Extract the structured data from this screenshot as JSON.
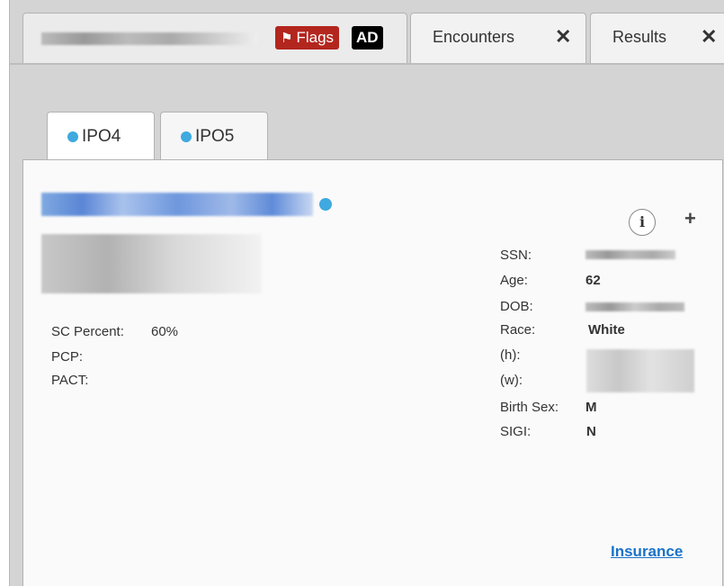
{
  "tabs": {
    "patient": {
      "flags_label": "Flags",
      "ad_label": "AD"
    },
    "encounters": {
      "label": "Encounters"
    },
    "results": {
      "label": "Results"
    }
  },
  "inner_tabs": [
    {
      "label": "IPO4",
      "dot_color": "#3fa9e0"
    },
    {
      "label": "IPO5",
      "dot_color": "#3fa9e0"
    }
  ],
  "patient_info": {
    "sc_percent_label": "SC Percent:",
    "sc_percent_value": "60%",
    "pcp_label": "PCP:",
    "pact_label": "PACT:"
  },
  "demographics": {
    "ssn_label": "SSN:",
    "age_label": "Age:",
    "age_value": "62",
    "dob_label": "DOB:",
    "race_label": "Race:",
    "race_value": "White",
    "home_phone_label": "(h):",
    "work_phone_label": "(w):",
    "birth_sex_label": "Birth Sex:",
    "birth_sex_value": "M",
    "sigi_label": "SIGI:",
    "sigi_value": "N"
  },
  "actions": {
    "info_icon": "info-icon",
    "add_icon": "plus-icon",
    "insurance_label": "Insurance"
  },
  "colors": {
    "accent": "#3fa9e0",
    "flags_bg": "#b3261e",
    "link": "#1a73c8"
  }
}
